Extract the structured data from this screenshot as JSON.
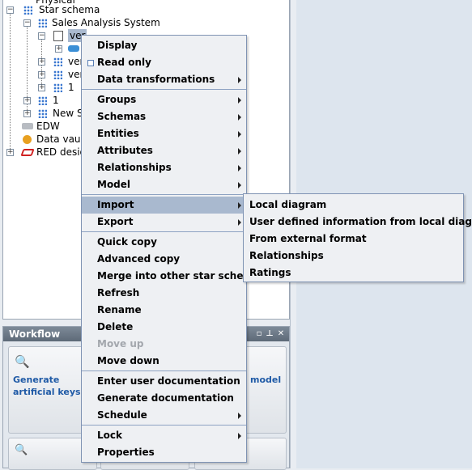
{
  "tree": {
    "items": [
      {
        "label": "Physical"
      },
      {
        "label": "Star schema"
      },
      {
        "label": "Sales Analysis System"
      },
      {
        "label": "ver"
      },
      {
        "label": "ver"
      },
      {
        "label": "ver"
      },
      {
        "label": "1"
      },
      {
        "label": "1"
      },
      {
        "label": "New S"
      },
      {
        "label": "EDW"
      },
      {
        "label": "Data vault"
      },
      {
        "label": "RED desig"
      }
    ]
  },
  "workflow": {
    "title": "Workflow",
    "cards": [
      {
        "label": "Generate artificial keys"
      },
      {
        "label": "model"
      }
    ]
  },
  "context_menu": {
    "items": [
      {
        "label": "Display"
      },
      {
        "label": "Read only"
      },
      {
        "label": "Data transformations"
      },
      {
        "label": "Groups"
      },
      {
        "label": "Schemas"
      },
      {
        "label": "Entities"
      },
      {
        "label": "Attributes"
      },
      {
        "label": "Relationships"
      },
      {
        "label": "Model"
      },
      {
        "label": "Import"
      },
      {
        "label": "Export"
      },
      {
        "label": "Quick copy"
      },
      {
        "label": "Advanced copy"
      },
      {
        "label": "Merge into other star schema"
      },
      {
        "label": "Refresh"
      },
      {
        "label": "Rename"
      },
      {
        "label": "Delete"
      },
      {
        "label": "Move up"
      },
      {
        "label": "Move down"
      },
      {
        "label": "Enter user documentation"
      },
      {
        "label": "Generate documentation"
      },
      {
        "label": "Schedule"
      },
      {
        "label": "Lock"
      },
      {
        "label": "Properties"
      }
    ]
  },
  "import_submenu": {
    "items": [
      {
        "label": "Local diagram"
      },
      {
        "label": "User defined information from local diagram"
      },
      {
        "label": "From external format"
      },
      {
        "label": "Relationships"
      },
      {
        "label": "Ratings"
      }
    ]
  },
  "colors": {
    "menu_bg": "#eef0f3",
    "highlight": "#a9b9cf",
    "link": "#1f5aa6",
    "header": "#6b7785"
  }
}
